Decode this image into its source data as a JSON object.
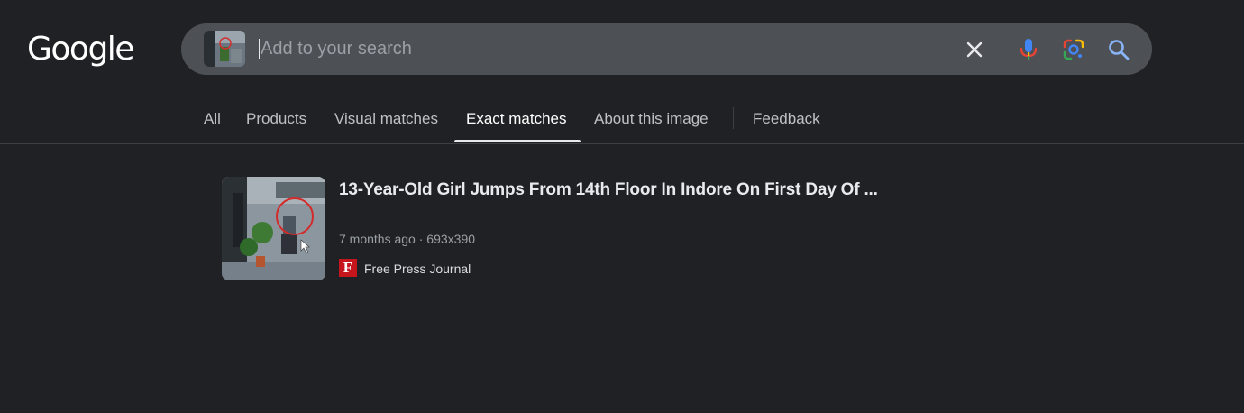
{
  "header": {
    "logo_text": "Google",
    "search": {
      "placeholder": "Add to your search",
      "value": ""
    },
    "icons": {
      "clear": "close-icon",
      "voice": "mic-icon",
      "lens": "lens-icon",
      "search": "search-icon"
    }
  },
  "tabs": [
    {
      "label": "All",
      "active": false
    },
    {
      "label": "Products",
      "active": false
    },
    {
      "label": "Visual matches",
      "active": false
    },
    {
      "label": "Exact matches",
      "active": true
    },
    {
      "label": "About this image",
      "active": false
    },
    {
      "label": "Feedback",
      "active": false
    }
  ],
  "results": [
    {
      "title": "13-Year-Old Girl Jumps From 14th Floor In Indore On First Day Of ...",
      "age": "7 months ago",
      "dimensions": "693x390",
      "source_name": "Free Press Journal",
      "favicon_letter": "F"
    }
  ],
  "colors": {
    "background": "#202124",
    "searchbar": "#4d5156",
    "favicon_red": "#c5161d",
    "mic_blue": "#4285f4",
    "mic_red": "#ea4335",
    "search_blue": "#8ab4f8"
  }
}
